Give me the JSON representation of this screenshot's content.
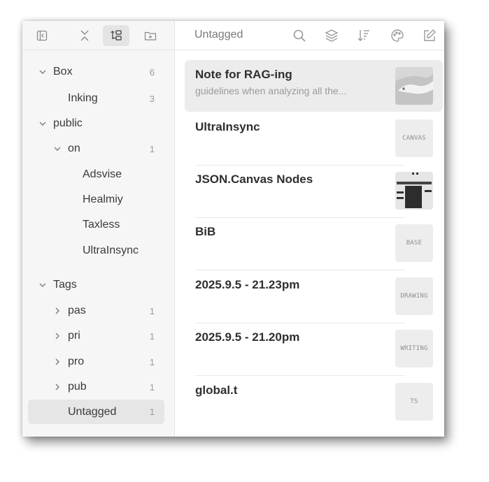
{
  "sidebar": {
    "toolbar": {
      "buttons": [
        {
          "icon": "collapse-sidebar-icon"
        },
        {
          "icon": "collapse-all-icon"
        },
        {
          "icon": "hierarchy-icon"
        },
        {
          "icon": "new-folder-icon"
        }
      ]
    },
    "tree": [
      {
        "label": "Box",
        "count": "6",
        "expanded": true,
        "icon": "chevron-down-icon"
      },
      {
        "label": "Inking",
        "count": "3"
      },
      {
        "label": "public",
        "count": "",
        "expanded": true,
        "icon": "chevron-down-icon"
      },
      {
        "label": "on",
        "count": "1",
        "expanded": true,
        "icon": "chevron-down-icon"
      },
      {
        "label": "Adsvise",
        "count": ""
      },
      {
        "label": "Healmiy",
        "count": ""
      },
      {
        "label": "Taxless",
        "count": ""
      },
      {
        "label": "UltraInsync",
        "count": ""
      },
      {
        "label": "Tags",
        "count": "",
        "expanded": true,
        "icon": "chevron-down-icon"
      },
      {
        "label": "pas",
        "count": "1",
        "icon": "chevron-right-icon"
      },
      {
        "label": "pri",
        "count": "1",
        "icon": "chevron-right-icon"
      },
      {
        "label": "pro",
        "count": "1",
        "icon": "chevron-right-icon"
      },
      {
        "label": "pub",
        "count": "1",
        "icon": "chevron-right-icon"
      },
      {
        "label": "Untagged",
        "count": "1",
        "selected": true
      }
    ]
  },
  "notes_pane": {
    "title": "Untagged",
    "toolbar_icons": [
      "search-icon",
      "layers-icon",
      "sort-icon",
      "palette-icon",
      "edit-icon"
    ],
    "notes": [
      {
        "title": "Note for RAG-ing",
        "preview": "guidelines when analyzing all the...",
        "thumb": ""
      },
      {
        "title": "UltraInsync",
        "preview": "",
        "thumb": "CANVAS"
      },
      {
        "title": "JSON.Canvas Nodes",
        "preview": "",
        "thumb": ""
      },
      {
        "title": "BiB",
        "preview": "",
        "thumb": "BASE"
      },
      {
        "title": "2025.9.5 - 21.23pm",
        "preview": "",
        "thumb": "DRAWING"
      },
      {
        "title": "2025.9.5 - 21.20pm",
        "preview": "",
        "thumb": "WRITING"
      },
      {
        "title": "global.t",
        "preview": "",
        "thumb": "TS"
      }
    ]
  }
}
